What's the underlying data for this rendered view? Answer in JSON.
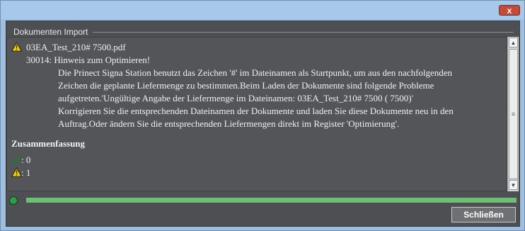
{
  "window": {
    "title": "",
    "close_glyph": "x"
  },
  "group": {
    "title": "Dokumenten Import"
  },
  "messages": [
    {
      "icon": "warning-icon",
      "file": "03EA_Test_210# 7500.pdf"
    },
    {
      "code_line": "30014: Hinweis zum Optimieren!"
    }
  ],
  "details": [
    "Die Prinect Signa Station benutzt das Zeichen '#' im Dateinamen als Startpunkt, um aus den nachfolgenden",
    "Zeichen die geplante Liefermenge zu bestimmen.Beim Laden der Dokumente sind folgende Probleme",
    "aufgetreten.'Ungültige Angabe der Liefermenge im Dateinamen: 03EA_Test_210# 7500 ( 7500)'",
    "Korrigieren Sie die entsprechenden Dateinamen der Dokumente und laden Sie diese Dokumente neu in den",
    "Auftrag.Oder ändern Sie die entsprechenden Liefermengen direkt im Register 'Optimierung'."
  ],
  "summary": {
    "heading": "Zusammenfassung",
    "ok_label": ": 0",
    "warning_label": ": 1"
  },
  "progress": {
    "fraction": 1.0
  },
  "colors": {
    "accent_green": "#66c56b",
    "status_dot": "#29a04a",
    "warning": "#f3d000"
  },
  "buttons": {
    "close_label": "Schließen"
  }
}
